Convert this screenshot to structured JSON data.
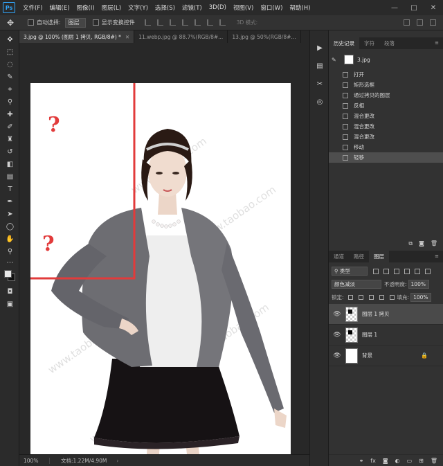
{
  "app": {
    "logo": "Ps"
  },
  "menu": [
    "文件(F)",
    "编辑(E)",
    "图像(I)",
    "图层(L)",
    "文字(Y)",
    "选择(S)",
    "滤镜(T)",
    "3D(D)",
    "视图(V)",
    "窗口(W)",
    "帮助(H)"
  ],
  "window_controls": [
    "—",
    "□",
    "✕"
  ],
  "options_bar": {
    "auto_select_label": "自动选择:",
    "auto_select_value": "图层",
    "show_transform_label": "显示变换控件",
    "mode_3d_label": "3D 模式:"
  },
  "doc_tabs": [
    {
      "label": "3.jpg @ 100% (图层 1 拷贝, RGB/8#) *",
      "active": true
    },
    {
      "label": "11.webp.jpg @ 88.7%(RGB/8#...",
      "active": false
    },
    {
      "label": "13.jpg @ 50%(RGB/8#...",
      "active": false
    }
  ],
  "canvas": {
    "annotation_mark_1": "?",
    "annotation_mark_2": "?",
    "watermark": "www.taobao.com",
    "box_color": "#e23b3b"
  },
  "status": {
    "zoom": "100%",
    "doc_info": "文档:1.22M/4.90M",
    "arrow": "›"
  },
  "history_panel": {
    "tabs": [
      "历史记录",
      "字符",
      "段落"
    ],
    "snapshot": "3.jpg",
    "items": [
      {
        "label": "打开",
        "selected": false
      },
      {
        "label": "矩形选框",
        "selected": false
      },
      {
        "label": "通过拷贝的图层",
        "selected": false
      },
      {
        "label": "反相",
        "selected": false
      },
      {
        "label": "混合更改",
        "selected": false
      },
      {
        "label": "混合更改",
        "selected": false
      },
      {
        "label": "混合更改",
        "selected": false
      },
      {
        "label": "移动",
        "selected": false
      },
      {
        "label": "轻移",
        "selected": true
      }
    ]
  },
  "layers_panel": {
    "tabs": [
      "通道",
      "路径",
      "图层"
    ],
    "filter_kind": "类型",
    "blend_mode": "颜色减淡",
    "opacity_label": "不透明度:",
    "opacity_value": "100%",
    "lock_label": "锁定:",
    "fill_label": "填充:",
    "fill_value": "100%",
    "layers": [
      {
        "name": "图层 1 拷贝",
        "selected": true
      },
      {
        "name": "图层 1",
        "selected": false
      },
      {
        "name": "背景",
        "selected": false,
        "locked": true
      }
    ],
    "footer_fx": "fx"
  },
  "icons": {
    "eye": "eye-icon",
    "lock": "lock-icon",
    "move": "move-tool-icon"
  }
}
